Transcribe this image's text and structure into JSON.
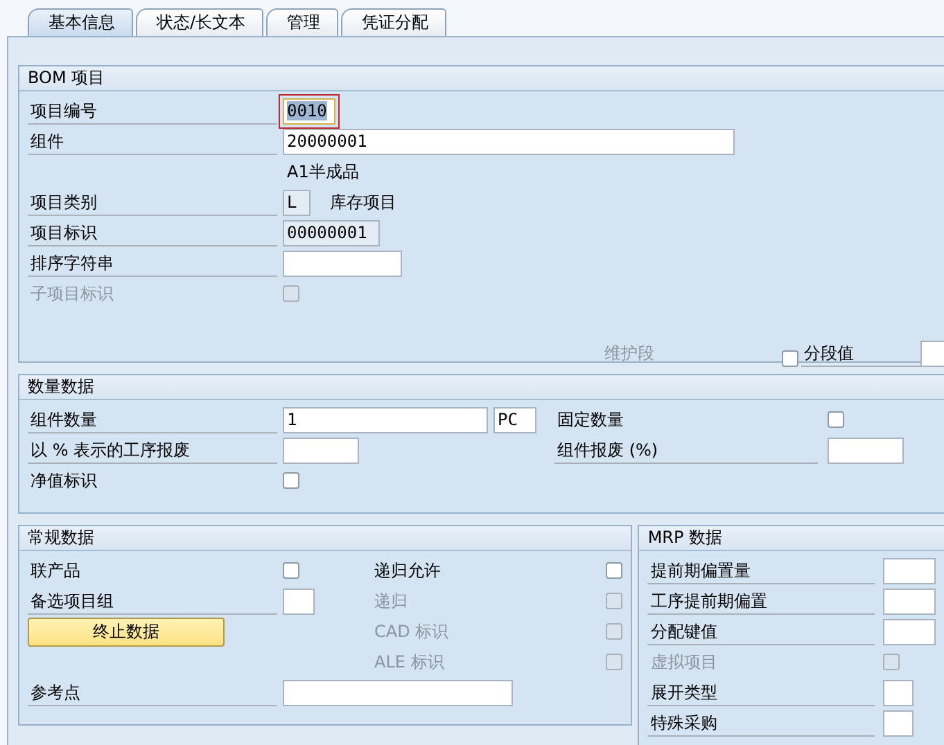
{
  "tabs": [
    {
      "label": "基本信息",
      "selected": true
    },
    {
      "label": "状态/长文本",
      "selected": false
    },
    {
      "label": "管理",
      "selected": false
    },
    {
      "label": "凭证分配",
      "selected": false
    }
  ],
  "bom_item": {
    "title": "BOM 项目",
    "rows": [
      {
        "kind": "input",
        "label": "项目编号",
        "disabled": false,
        "value": "0010",
        "focused": true
      },
      {
        "kind": "input",
        "label": "组件",
        "disabled": false,
        "value": "20000001",
        "focused": false
      },
      {
        "kind": "note",
        "value": "A1半成品"
      },
      {
        "kind": "display",
        "label": "项目类别",
        "disabled": false,
        "value": "L",
        "note": "库存项目"
      },
      {
        "kind": "display",
        "label": "项目标识",
        "disabled": false,
        "value": "00000001"
      },
      {
        "kind": "input",
        "label": "排序字符串",
        "disabled": false,
        "focused": false
      },
      {
        "kind": "checkbox",
        "label": "子项目标识",
        "disabled": true,
        "checked": false
      }
    ],
    "segment": {
      "label": "维护段",
      "disabled": true,
      "checkbox_label": "分段值",
      "checked": false
    }
  },
  "quantity_data": {
    "title": "数量数据",
    "rows": [
      {
        "left": {
          "kind": "input",
          "label": "组件数量",
          "disabled": false,
          "value": "1",
          "focused": false,
          "unit": "PC"
        },
        "right": {
          "kind": "checkbox",
          "label": "固定数量",
          "disabled": false,
          "checked": false
        }
      },
      {
        "left": {
          "kind": "input",
          "label": "以 % 表示的工序报废",
          "disabled": false,
          "focused": false
        },
        "right": {
          "kind": "input",
          "label": "组件报废 (%)",
          "disabled": false,
          "focused": false
        }
      },
      {
        "left": {
          "kind": "checkbox",
          "label": "净值标识",
          "disabled": false,
          "checked": false
        }
      }
    ]
  },
  "general_data": {
    "title": "常规数据",
    "rows": [
      {
        "left": {
          "kind": "checkbox",
          "label": "联产品",
          "disabled": false,
          "checked": false
        },
        "right": {
          "kind": "checkbox",
          "label": "递归允许",
          "disabled": false,
          "checked": false
        }
      },
      {
        "left": {
          "kind": "input",
          "label": "备选项目组",
          "disabled": false,
          "focused": false
        },
        "right": {
          "kind": "checkbox",
          "label": "递归",
          "disabled": true,
          "checked": false
        }
      },
      {
        "left": {
          "kind": "button",
          "label": "终止数据"
        },
        "right": {
          "kind": "checkbox",
          "label": "CAD 标识",
          "disabled": true,
          "checked": false
        }
      },
      {
        "right": {
          "kind": "checkbox",
          "label": "ALE 标识",
          "disabled": true,
          "checked": false
        }
      },
      {
        "left": {
          "kind": "input",
          "label": "参考点",
          "disabled": false,
          "focused": false
        }
      }
    ]
  },
  "mrp_data": {
    "title": "MRP 数据",
    "rows": [
      {
        "kind": "input",
        "label": "提前期偏置量",
        "disabled": false,
        "focused": false
      },
      {
        "kind": "input",
        "label": "工序提前期偏置",
        "disabled": false,
        "focused": false
      },
      {
        "kind": "input",
        "label": "分配键值",
        "disabled": false,
        "focused": false
      },
      {
        "kind": "checkbox",
        "label": "虚拟项目",
        "disabled": true,
        "checked": false
      },
      {
        "kind": "input",
        "label": "展开类型",
        "disabled": false,
        "focused": false
      },
      {
        "kind": "input",
        "label": "特殊采购",
        "disabled": false,
        "focused": false
      }
    ]
  }
}
